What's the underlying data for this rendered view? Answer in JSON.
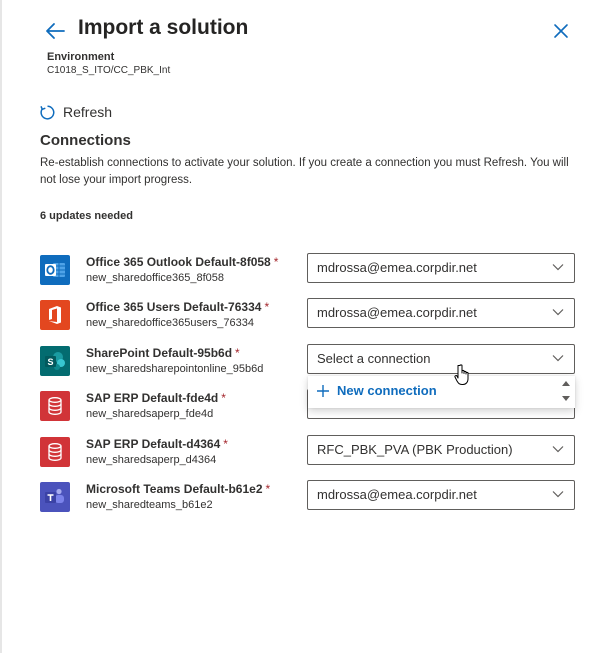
{
  "header": {
    "title": "Import a solution",
    "environment_label": "Environment",
    "environment_value": "C1018_S_ITO/CC_PBK_Int"
  },
  "toolbar": {
    "refresh_label": "Refresh"
  },
  "connections": {
    "title": "Connections",
    "description": "Re-establish connections to activate your solution. If you create a connection you must Refresh. You will not lose your import progress.",
    "updates_needed": "6 updates needed",
    "required_mark": "*",
    "rows": [
      {
        "name": "Office 365 Outlook Default-8f058",
        "logical_name": "new_sharedoffice365_8f058",
        "value": "mdrossa@emea.corpdir.net",
        "icon": "outlook-icon",
        "color": "#0f6cbd"
      },
      {
        "name": "Office 365 Users Default-76334",
        "logical_name": "new_sharedoffice365users_76334",
        "value": "mdrossa@emea.corpdir.net",
        "icon": "office-icon",
        "color": "#e3471f"
      },
      {
        "name": "SharePoint Default-95b6d",
        "logical_name": "new_sharedsharepointonline_95b6d",
        "value": "Select a connection",
        "icon": "sharepoint-icon",
        "color": "#036c70"
      },
      {
        "name": "SAP ERP Default-fde4d",
        "logical_name": "new_sharedsaperp_fde4d",
        "value": "",
        "icon": "database-icon",
        "color": "#d13438"
      },
      {
        "name": "SAP ERP Default-d4364",
        "logical_name": "new_sharedsaperp_d4364",
        "value": "RFC_PBK_PVA (PBK Production)",
        "icon": "database-icon",
        "color": "#d13438"
      },
      {
        "name": "Microsoft Teams Default-b61e2",
        "logical_name": "new_sharedteams_b61e2",
        "value": "mdrossa@emea.corpdir.net",
        "icon": "teams-icon",
        "color": "#4b53bc"
      }
    ]
  },
  "dropdown": {
    "new_connection_label": "New connection"
  }
}
